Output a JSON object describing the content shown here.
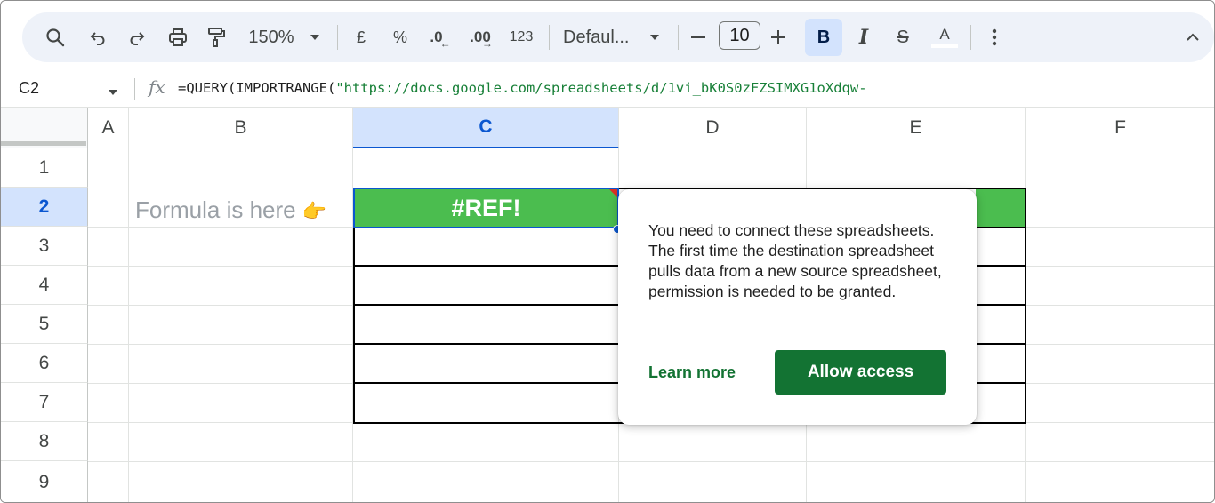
{
  "toolbar": {
    "zoom": "150%",
    "currency": "£",
    "percent": "%",
    "decrease_decimal": ".0",
    "increase_decimal": ".00",
    "number_format": "123",
    "font_family": "Defaul...",
    "font_size": "10",
    "text_color_label": "A"
  },
  "formula_bar": {
    "cell_ref": "C2",
    "fx": "fx",
    "formula_prefix": "=QUERY(IMPORTRANGE(",
    "formula_string": "\"https://docs.google.com/spreadsheets/d/1vi_bK0S0zFZSIMXG1oXdqw-"
  },
  "columns": [
    "A",
    "B",
    "C",
    "D",
    "E",
    "F"
  ],
  "rows": [
    "1",
    "2",
    "3",
    "4",
    "5",
    "6",
    "7",
    "8",
    "9"
  ],
  "selected": {
    "column": "C",
    "row": "2"
  },
  "cells": {
    "b2": "Formula is here",
    "b2_pointer": "👉",
    "c2": "#REF!"
  },
  "popup": {
    "message": "You need to connect these spreadsheets. The first time the destination spreadsheet pulls data from a new source spreadsheet, permission is needed to be granted.",
    "learn_more": "Learn more",
    "allow_access": "Allow access"
  },
  "colors": {
    "accent": "#0b57d0",
    "cell_green": "#4bbd4f",
    "button_green": "#137333"
  }
}
